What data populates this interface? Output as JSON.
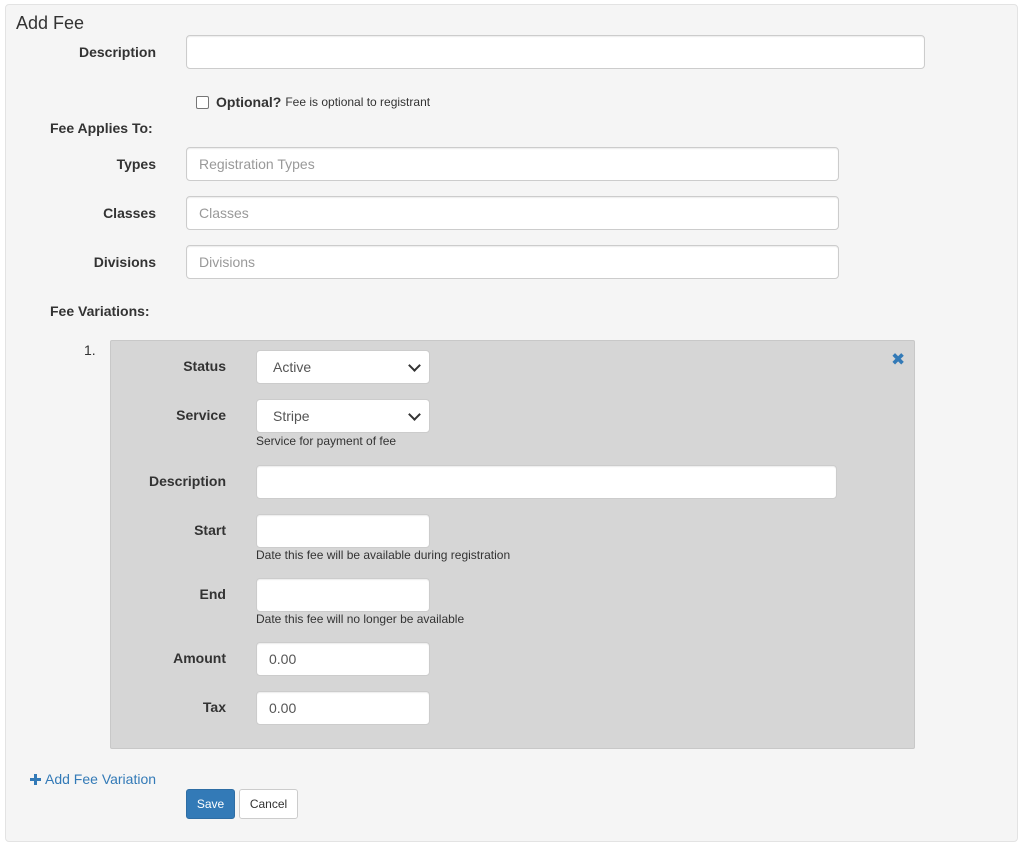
{
  "form": {
    "title": "Add Fee",
    "description_label": "Description",
    "description_value": "",
    "optional_label": "Optional?",
    "optional_help": "Fee is optional to registrant",
    "optional_checked": false,
    "applies_to_heading": "Fee Applies To:",
    "types_label": "Types",
    "types_placeholder": "Registration Types",
    "classes_label": "Classes",
    "classes_placeholder": "Classes",
    "divisions_label": "Divisions",
    "divisions_placeholder": "Divisions",
    "variations_heading": "Fee Variations:"
  },
  "variation": {
    "index": "1.",
    "status_label": "Status",
    "status_value": "Active",
    "service_label": "Service",
    "service_value": "Stripe",
    "service_help": "Service for payment of fee",
    "description_label": "Description",
    "description_value": "",
    "start_label": "Start",
    "start_value": "",
    "start_help": "Date this fee will be available during registration",
    "end_label": "End",
    "end_value": "",
    "end_help": "Date this fee will no longer be available",
    "amount_label": "Amount",
    "amount_value": "0.00",
    "tax_label": "Tax",
    "tax_value": "0.00",
    "remove_icon": "close-icon"
  },
  "actions": {
    "add_variation_label": "Add Fee Variation",
    "save_label": "Save",
    "cancel_label": "Cancel"
  },
  "colors": {
    "primary": "#337ab7",
    "panel_bg": "#f5f5f5",
    "variation_bg": "#d6d6d6"
  }
}
